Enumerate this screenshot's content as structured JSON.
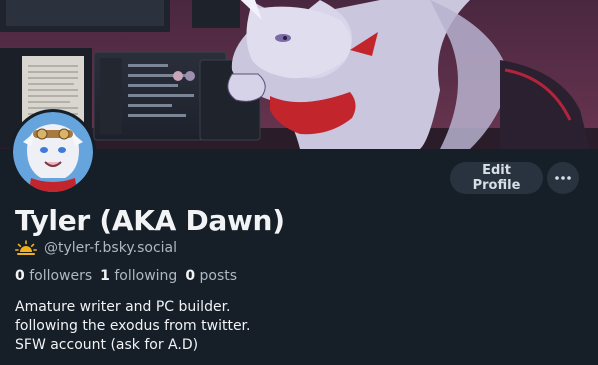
{
  "banner": {
    "icon": "dragon-artwork-banner"
  },
  "avatar": {
    "icon": "dragon-avatar"
  },
  "actions": {
    "edit_profile_label": "Edit Profile",
    "more_icon": "ellipsis-icon"
  },
  "profile": {
    "display_name": "Tyler (AKA Dawn)",
    "handle_icon": "sunrise-icon",
    "handle": "@tyler-f.bsky.social",
    "followers_count": "0",
    "followers_label": "followers",
    "following_count": "1",
    "following_label": "following",
    "posts_count": "0",
    "posts_label": "posts",
    "bio": [
      "Amature writer and PC builder.",
      "following the exodus from twitter.",
      "SFW account (ask for A.D)"
    ]
  },
  "colors": {
    "background": "#161e27",
    "button_bg": "#29333f",
    "muted_text": "#aeb7c2",
    "primary_text": "#f1f3f5"
  }
}
